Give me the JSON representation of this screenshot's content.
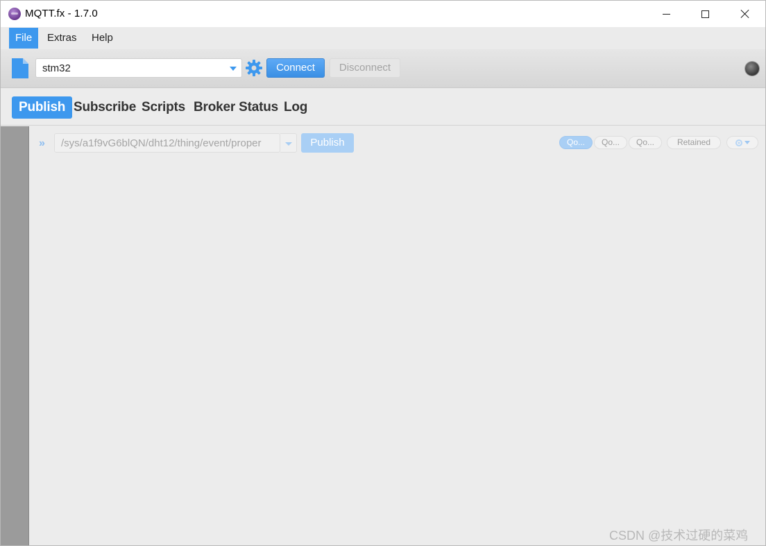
{
  "window": {
    "title": "MQTT.fx - 1.7.0",
    "app_icon": "mqttfx-logo-icon",
    "controls": [
      "minimize-icon",
      "maximize-icon",
      "close-icon"
    ]
  },
  "menubar": {
    "items": [
      {
        "label": "File",
        "active": true
      },
      {
        "label": "Extras"
      },
      {
        "label": "Help"
      }
    ]
  },
  "toolbar": {
    "profile_icon": "document-icon",
    "profile_value": "stm32",
    "settings_icon": "gear-icon",
    "connect_label": "Connect",
    "disconnect_label": "Disconnect",
    "status_icon": "connection-status-led",
    "accent_color": "#3d98ee"
  },
  "tabs": [
    {
      "label": "Publish",
      "active": true
    },
    {
      "label": "Subscribe"
    },
    {
      "label": "Scripts"
    },
    {
      "label": "Broker Status"
    },
    {
      "label": "Log"
    }
  ],
  "publish": {
    "expand_icon": "double-chevron-right-icon",
    "topic_value": "/sys/a1f9vG6blQN/dht12/thing/event/proper",
    "publish_label": "Publish",
    "qos": [
      {
        "label": "Qo...",
        "selected": true
      },
      {
        "label": "Qo..."
      },
      {
        "label": "Qo..."
      }
    ],
    "retained_label": "Retained",
    "options_icon": "settings-dropdown-icon"
  },
  "watermark": "CSDN @技术过硬的菜鸡"
}
